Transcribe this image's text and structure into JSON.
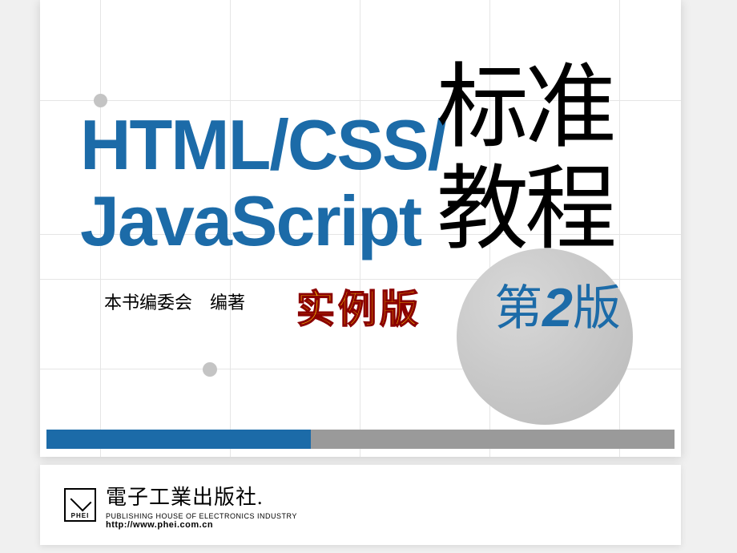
{
  "cover": {
    "tech_line1": "HTML/CSS/",
    "tech_line2": "JavaScript",
    "title_cn_line1": "标准",
    "title_cn_line2": "教程",
    "edition_prefix": "第",
    "edition_number": "2",
    "edition_suffix": "版",
    "example_label": "实例版",
    "author": "本书编委会　编著"
  },
  "publisher": {
    "logo_text": "PHEI",
    "name_cn": "電子工業出版社.",
    "name_en": "PUBLISHING HOUSE OF ELECTRONICS INDUSTRY",
    "url": "http://www.phei.com.cn"
  }
}
